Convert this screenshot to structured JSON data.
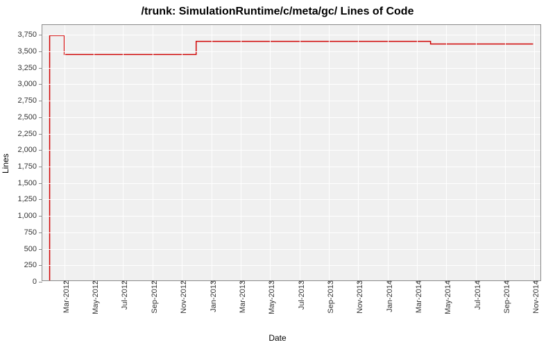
{
  "chart_data": {
    "type": "line",
    "title": "/trunk: SimulationRuntime/c/meta/gc/ Lines of Code",
    "xlabel": "Date",
    "ylabel": "Lines",
    "ylim": [
      0,
      3900
    ],
    "ytick_step": 250,
    "yticks": [
      0,
      250,
      500,
      750,
      1000,
      1250,
      1500,
      1750,
      2000,
      2250,
      2500,
      2750,
      3000,
      3250,
      3500,
      3750
    ],
    "xticks": [
      "Mar-2012",
      "May-2012",
      "Jul-2012",
      "Sep-2012",
      "Nov-2012",
      "Jan-2013",
      "Mar-2013",
      "May-2013",
      "Jul-2013",
      "Sep-2013",
      "Nov-2013",
      "Jan-2014",
      "Mar-2014",
      "May-2014",
      "Jul-2014",
      "Sep-2014",
      "Nov-2014"
    ],
    "series": [
      {
        "name": "Lines of Code",
        "color": "#d00000",
        "points": [
          {
            "x": "Feb-2012",
            "y": 0
          },
          {
            "x": "Feb-2012",
            "y": 3740
          },
          {
            "x": "Mar-2012",
            "y": 3740
          },
          {
            "x": "Mar-2012",
            "y": 3450
          },
          {
            "x": "Dec-2012",
            "y": 3450
          },
          {
            "x": "Dec-2012",
            "y": 3650
          },
          {
            "x": "Apr-2014",
            "y": 3650
          },
          {
            "x": "Apr-2014",
            "y": 3610
          },
          {
            "x": "Nov-2014",
            "y": 3610
          }
        ]
      }
    ]
  }
}
